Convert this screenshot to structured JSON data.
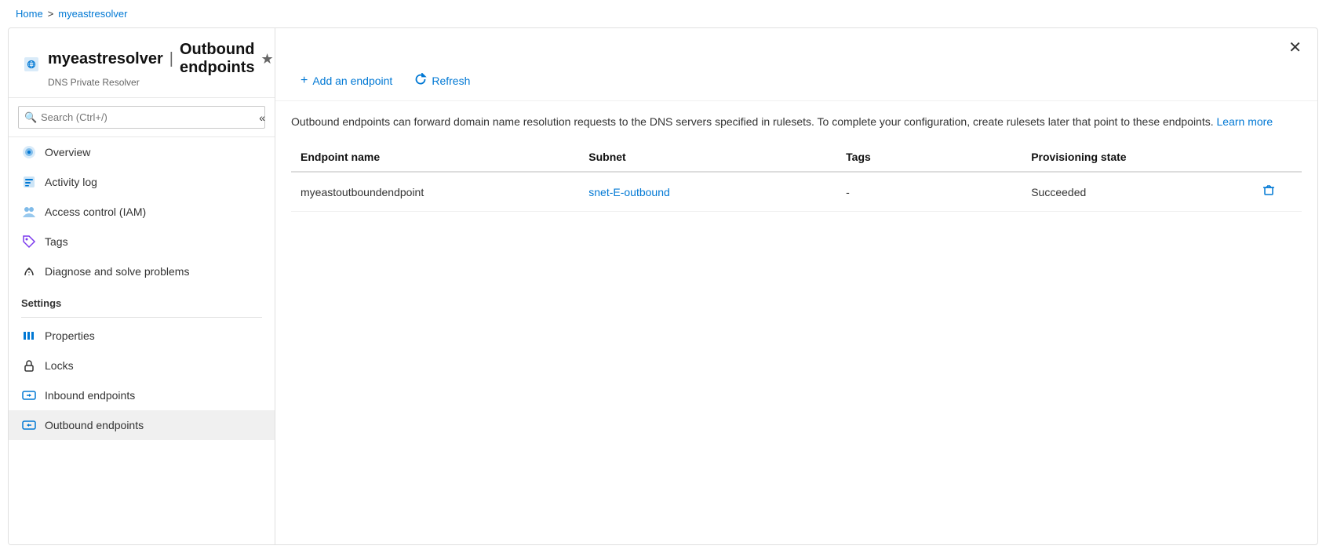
{
  "breadcrumb": {
    "home": "Home",
    "separator": ">",
    "resource": "myeastresolver"
  },
  "header": {
    "resource_name": "myeastresolver",
    "page_title": "Outbound endpoints",
    "subtitle": "DNS Private Resolver",
    "star_label": "★",
    "ellipsis_label": "···",
    "close_label": "✕"
  },
  "sidebar": {
    "search_placeholder": "Search (Ctrl+/)",
    "collapse_label": "«",
    "nav_items": [
      {
        "id": "overview",
        "label": "Overview"
      },
      {
        "id": "activity-log",
        "label": "Activity log"
      },
      {
        "id": "access-control",
        "label": "Access control (IAM)"
      },
      {
        "id": "tags",
        "label": "Tags"
      },
      {
        "id": "diagnose",
        "label": "Diagnose and solve problems"
      }
    ],
    "settings_label": "Settings",
    "settings_items": [
      {
        "id": "properties",
        "label": "Properties"
      },
      {
        "id": "locks",
        "label": "Locks"
      },
      {
        "id": "inbound-endpoints",
        "label": "Inbound endpoints"
      },
      {
        "id": "outbound-endpoints",
        "label": "Outbound endpoints",
        "active": true
      }
    ]
  },
  "toolbar": {
    "add_label": "Add an endpoint",
    "refresh_label": "Refresh"
  },
  "description": {
    "text": "Outbound endpoints can forward domain name resolution requests to the DNS servers specified in rulesets. To complete your configuration, create rulesets later that point to these endpoints.",
    "learn_more_label": "Learn more",
    "learn_more_url": "#"
  },
  "table": {
    "columns": [
      {
        "id": "name",
        "label": "Endpoint name"
      },
      {
        "id": "subnet",
        "label": "Subnet"
      },
      {
        "id": "tags",
        "label": "Tags"
      },
      {
        "id": "provisioning",
        "label": "Provisioning state"
      }
    ],
    "rows": [
      {
        "name": "myeastoutboundendpoint",
        "subnet": "snet-E-outbound",
        "tags": "-",
        "provisioning": "Succeeded"
      }
    ]
  }
}
